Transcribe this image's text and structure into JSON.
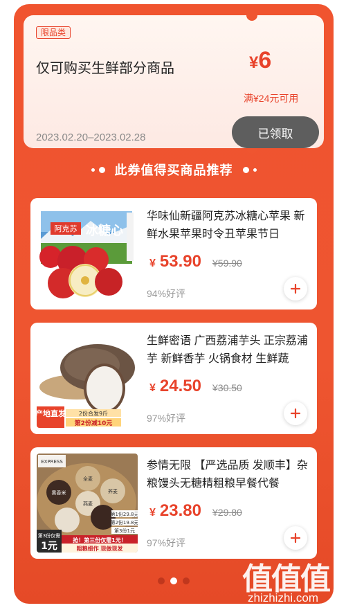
{
  "coupon": {
    "tag": "限品类",
    "title": "仅可购买生鲜部分商品",
    "currency": "¥",
    "amount": "6",
    "condition": "满¥24元可用",
    "date_range": "2023.02.20–2023.02.28",
    "claim_label": "已领取"
  },
  "section": {
    "title": "此券值得买商品推荐"
  },
  "products": [
    {
      "name": "华味仙新疆阿克苏冰糖心苹果 新鲜水果苹果时令丑苹果节日",
      "currency": "¥",
      "price": "53.90",
      "original_price": "¥59.90",
      "rating": "94%好评",
      "image_text": {
        "brand": "阿克苏",
        "title": "冰糖心"
      }
    },
    {
      "name": "生鲜密语 广西荔浦芋头 正宗荔浦芋 新鲜香芋 火锅食材 生鲜蔬",
      "currency": "¥",
      "price": "24.50",
      "original_price": "¥30.50",
      "rating": "97%好评",
      "image_text": {
        "badge": "产地直发",
        "promo1": "2份合发9斤",
        "promo2": "第2份减10元"
      }
    },
    {
      "name": "参情无限 【严选品质 发顺丰】杂粮馒头无糖精粗粮早餐代餐",
      "currency": "¥",
      "price": "23.80",
      "original_price": "¥29.80",
      "rating": "97%好评",
      "image_text": {
        "express": "EXPRESS",
        "buns": [
          "黑香米",
          "全麦",
          "燕麦",
          "荞麦",
          "黑香米",
          "全麦"
        ],
        "tiers": [
          "第1份29.8元",
          "第2份19.8元",
          "第3份1元"
        ],
        "offer_small": "第3份仅需",
        "offer_big": "1元",
        "slogan1": "抢！第三份仅需1元！",
        "slogan2": "粗粮细作 现做现发"
      }
    }
  ],
  "pagination": {
    "count": 3,
    "active": 2
  },
  "watermark": {
    "logo": "值值值",
    "text": "zhizhizhi.com"
  },
  "colors": {
    "accent": "#e8432b",
    "background": "#ef5530",
    "button": "#5e5e5e"
  },
  "icons": {
    "add": "plus-icon"
  }
}
